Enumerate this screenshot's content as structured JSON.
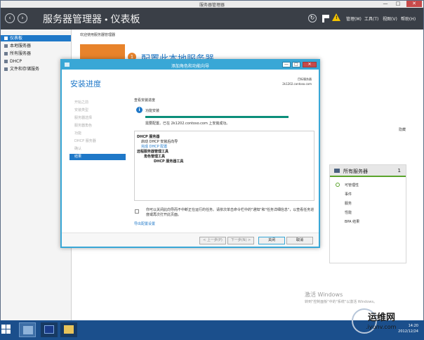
{
  "window": {
    "title": "服务器管理器",
    "minimize": "—",
    "maximize": "□",
    "close": "✕"
  },
  "header": {
    "breadcrumb_app": "服务器管理器",
    "breadcrumb_sep": "•",
    "breadcrumb_page": "仪表板",
    "menu": [
      "管理(M)",
      "工具(T)",
      "视图(V)",
      "帮助(H)"
    ]
  },
  "sidebar": {
    "items": [
      {
        "label": "仪表板",
        "active": true
      },
      {
        "label": "本地服务器"
      },
      {
        "label": "所有服务器"
      },
      {
        "label": "DHCP"
      },
      {
        "label": "文件和存储服务"
      }
    ]
  },
  "main": {
    "welcome": "欢迎使用服务器管理器",
    "config_number": "1",
    "config_title": "配置此本地服务器",
    "hide": "隐藏"
  },
  "servers_tile": {
    "title": "所有服务器",
    "count": "1",
    "rows": [
      "可管理性",
      "事件",
      "服务",
      "性能",
      "BPA 结果"
    ]
  },
  "activation": {
    "title": "激活 Windows",
    "subtitle": "转到\"控制面板\"中的\"系统\"以激活 Windows。"
  },
  "dialog": {
    "title": "添加角色和功能向导",
    "heading": "安装进度",
    "dest_label": "目标服务器",
    "dest_server": "2k1202.contoso.com",
    "steps": [
      "开始之前",
      "安装类型",
      "服务器选择",
      "服务器角色",
      "功能",
      "DHCP 服务器",
      "确认"
    ],
    "active_step": "结果",
    "view_label": "查看安装进度",
    "progress_label": "功能安装",
    "progress_percent": 100,
    "install_status": "需要配置。已在 2k1202.contoso.com 上安装成功。",
    "results": [
      {
        "text": "DHCP 服务器",
        "style": "bold"
      },
      {
        "text": "启动 DHCP 安装后向导",
        "style": "normal"
      },
      {
        "text": "完成 DHCP 配置",
        "style": "link"
      },
      {
        "text": "远程服务器管理工具",
        "style": "bold"
      },
      {
        "text": "角色管理工具",
        "style": "bold"
      },
      {
        "text": "DHCP 服务器工具",
        "style": "bold"
      }
    ],
    "note": "你可以关闭此向导而不中断正在运行的任务。请依次单击命令栏中的\"通知\"和\"任务详细信息\"，以查看任务进度或再次打开此页面。",
    "export_link": "导出配置设置",
    "buttons": {
      "prev": "< 上一步(P)",
      "next": "下一步(N) >",
      "close": "关闭",
      "cancel": "取消"
    }
  },
  "taskbar": {
    "time": "14:20",
    "date": "2012/12/24"
  },
  "watermark": {
    "text": "运维网",
    "url": ".iyunv.com"
  }
}
